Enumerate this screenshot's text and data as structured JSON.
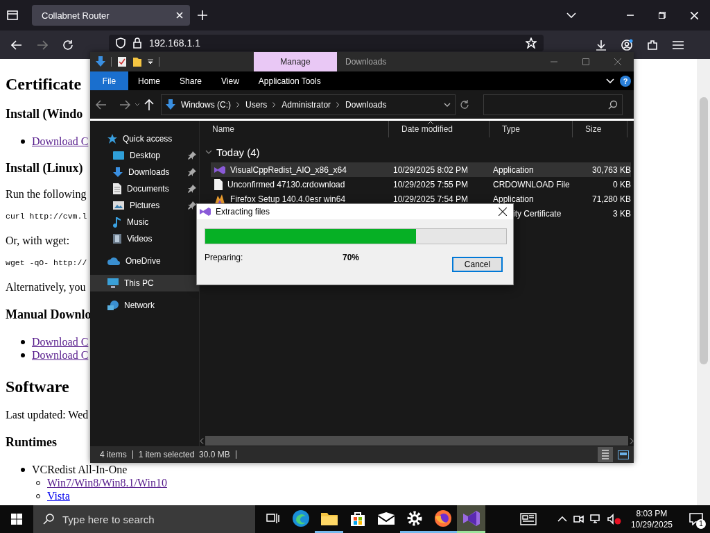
{
  "browser": {
    "tab": {
      "title": "Collabnet Router"
    },
    "url": "192.168.1.1",
    "page": [
      {
        "kind": "heading",
        "text": "Certificate"
      },
      {
        "kind": "subheading",
        "text": "Install (Windo"
      },
      {
        "kind": "list",
        "items": [
          {
            "text": "Download C",
            "link": true,
            "visited": true
          }
        ]
      },
      {
        "kind": "subheading",
        "text": "Install (Linux)"
      },
      {
        "kind": "p",
        "text": "Run the following"
      },
      {
        "kind": "code",
        "text": "curl http://cvm.l"
      },
      {
        "kind": "p",
        "text": "Or, with wget:"
      },
      {
        "kind": "code",
        "text": "wget -qO- http://"
      },
      {
        "kind": "p",
        "text": "Alternatively, you"
      },
      {
        "kind": "subheading",
        "text": "Manual Downlo"
      },
      {
        "kind": "list",
        "items": [
          {
            "text": "Download C",
            "link": true,
            "visited": true
          },
          {
            "text": "Download C",
            "link": true,
            "visited": true
          }
        ]
      },
      {
        "kind": "heading",
        "text": "Software"
      },
      {
        "kind": "p",
        "text": "Last updated: Wed"
      },
      {
        "kind": "subheading",
        "text": "Runtimes"
      },
      {
        "kind": "list",
        "items": [
          {
            "text": "VCRedist All-In-One",
            "link": false,
            "children": [
              {
                "text": "Win7/Win8/Win8.1/Win10",
                "link": true,
                "visited": true
              },
              {
                "text": "Vista",
                "link": true,
                "visited": false
              }
            ]
          }
        ]
      }
    ]
  },
  "explorer": {
    "context_tab": "Manage",
    "title": "Downloads",
    "ribbon_tabs": [
      {
        "label": "File",
        "kind": "file",
        "selected": false
      },
      {
        "label": "Home",
        "kind": "tab",
        "selected": false
      },
      {
        "label": "Share",
        "kind": "tab",
        "selected": false
      },
      {
        "label": "View",
        "kind": "tab",
        "selected": false
      },
      {
        "label": "Application Tools",
        "kind": "tab",
        "selected": false
      }
    ],
    "help": "?",
    "breadcrumb": [
      "Windows (C:)",
      "Users",
      "Administrator",
      "Downloads"
    ],
    "nav": [
      {
        "label": "Quick access",
        "kind": "star",
        "selected": false,
        "children": [
          {
            "label": "Desktop",
            "kind": "desktop",
            "pinned": true,
            "selected": false
          },
          {
            "label": "Downloads",
            "kind": "download",
            "pinned": true,
            "selected": false
          },
          {
            "label": "Documents",
            "kind": "document",
            "pinned": true,
            "selected": false
          },
          {
            "label": "Pictures",
            "kind": "pictures",
            "pinned": true,
            "selected": false
          },
          {
            "label": "Music",
            "kind": "music",
            "pinned": false,
            "selected": false
          },
          {
            "label": "Videos",
            "kind": "videos",
            "pinned": false,
            "selected": false
          }
        ]
      },
      {
        "label": "OneDrive",
        "kind": "cloud",
        "selected": false
      },
      {
        "label": "This PC",
        "kind": "pc",
        "selected": true
      },
      {
        "label": "Network",
        "kind": "network",
        "selected": false
      }
    ],
    "columns": [
      "Name",
      "Date modified",
      "Type",
      "Size"
    ],
    "group": "Today (4)",
    "rows": [
      {
        "name": "VisualCppRedist_AIO_x86_x64",
        "kind": "installer",
        "date": "10/29/2025 8:02 PM",
        "type": "Application",
        "size": "30,763 KB",
        "selected": true
      },
      {
        "name": "Unconfirmed 47130.crdownload",
        "kind": "file",
        "date": "10/29/2025 7:55 PM",
        "type": "CRDOWNLOAD File",
        "size": "0 KB",
        "selected": false
      },
      {
        "name": "Firefox Setup 140.4.0esr win64",
        "kind": "setup",
        "date": "10/29/2025 7:54 PM",
        "type": "Application",
        "size": "71,280 KB",
        "selected": false
      },
      {
        "type": "ity Certificate",
        "size": "3 KB",
        "selected": false
      }
    ],
    "status": [
      "4 items",
      "1 item selected  30.0 MB"
    ]
  },
  "dialog": {
    "title": "Extracting files",
    "level": 0.7,
    "status": "Preparing:",
    "percent": "70%",
    "button": "Cancel"
  },
  "taskbar": {
    "search": {
      "placeholder": "Type here to search"
    },
    "apps": [
      {
        "kind": "task-view",
        "running": false,
        "selected": false
      },
      {
        "kind": "edge",
        "running": false,
        "selected": false
      },
      {
        "kind": "folder",
        "running": true,
        "selected": false
      },
      {
        "kind": "store",
        "running": false,
        "selected": false
      },
      {
        "kind": "mail",
        "running": false,
        "selected": false
      },
      {
        "kind": "settings",
        "running": true,
        "selected": false
      },
      {
        "kind": "firefox",
        "running": true,
        "selected": false
      },
      {
        "kind": "installer",
        "running": true,
        "selected": true
      }
    ],
    "time": "8:03 PM",
    "date": "10/29/2025",
    "notifications": "1"
  }
}
